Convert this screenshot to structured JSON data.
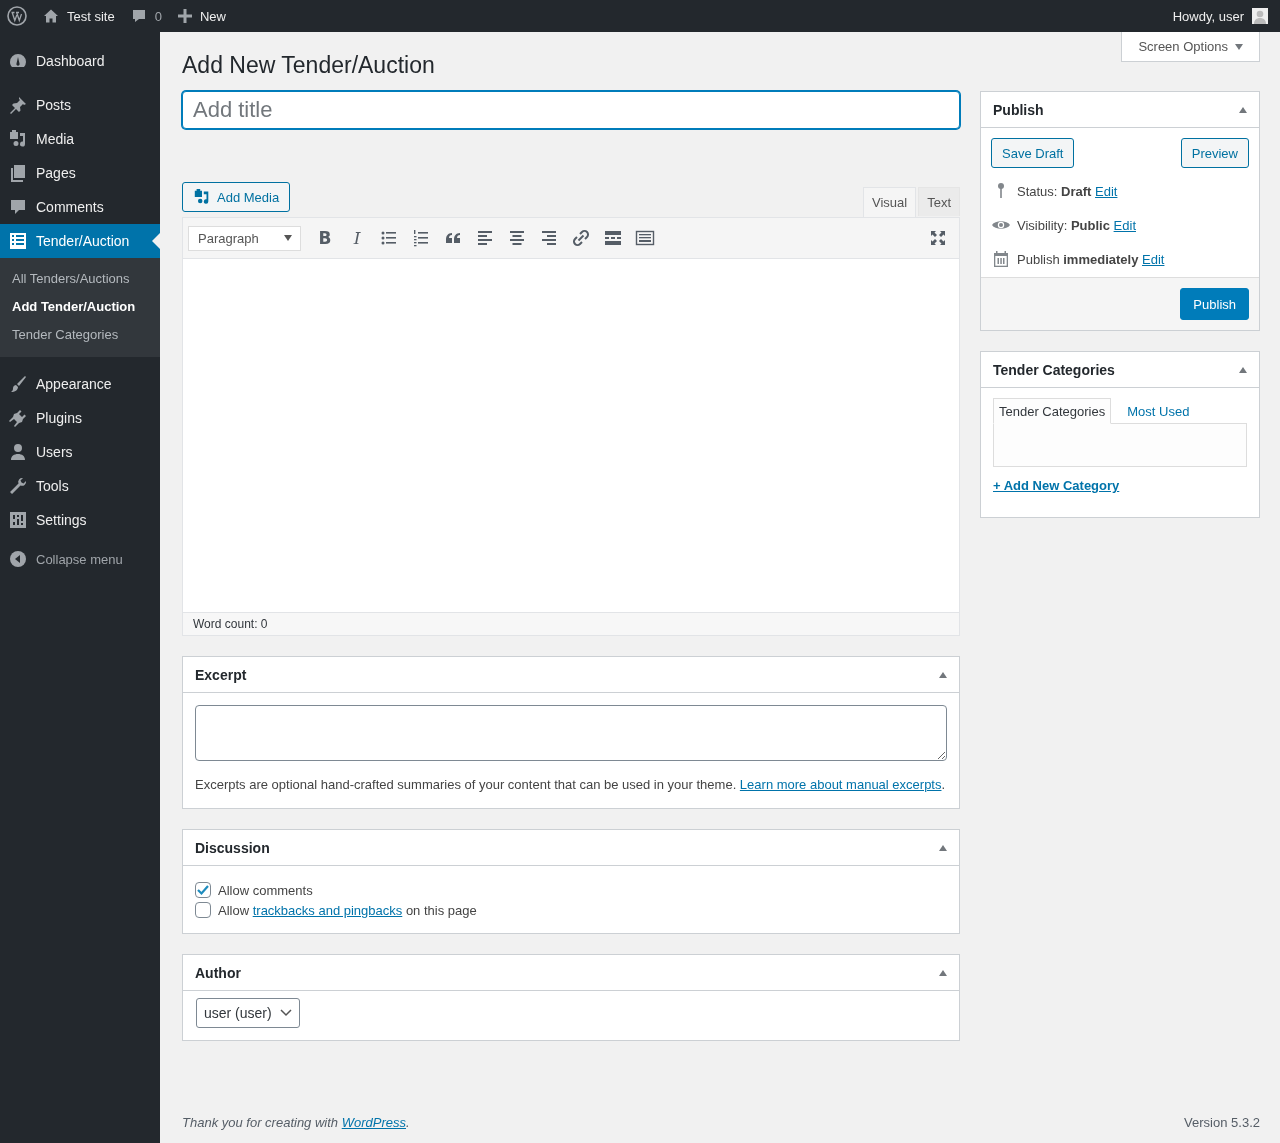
{
  "admin_bar": {
    "site": "Test site",
    "comments": "0",
    "new": "New",
    "greeting": "Howdy, user"
  },
  "menu": [
    {
      "items": [
        {
          "label": "Dashboard",
          "selected": false
        }
      ]
    },
    {
      "items": [
        {
          "label": "Posts",
          "selected": false
        },
        {
          "label": "Media",
          "selected": false
        },
        {
          "label": "Pages",
          "selected": false
        },
        {
          "label": "Comments",
          "selected": false
        },
        {
          "label": "Tender/Auction",
          "selected": true,
          "submenu": [
            {
              "label": "All Tenders/Auctions",
              "selected": false
            },
            {
              "label": "Add Tender/Auction",
              "selected": true
            },
            {
              "label": "Tender Categories",
              "selected": false
            }
          ]
        }
      ]
    },
    {
      "items": [
        {
          "label": "Appearance",
          "selected": false
        },
        {
          "label": "Plugins",
          "selected": false
        },
        {
          "label": "Users",
          "selected": false
        },
        {
          "label": "Tools",
          "selected": false
        },
        {
          "label": "Settings",
          "selected": false
        }
      ]
    }
  ],
  "collapse": "Collapse menu",
  "screen_options": "Screen Options",
  "page_title": "Add New Tender/Auction",
  "title_field": {
    "placeholder": "Add title"
  },
  "editor": {
    "add_media": "Add Media",
    "tabs": [
      {
        "label": "Visual",
        "selected": true
      },
      {
        "label": "Text",
        "selected": false
      }
    ],
    "format": "Paragraph",
    "glyphs": [
      "B",
      "I"
    ],
    "word_count": "Word count: 0"
  },
  "excerpt": {
    "title": "Excerpt",
    "note": "Excerpts are optional hand-crafted summaries of your content that can be used in your theme. ",
    "link": "Learn more about manual excerpts",
    "after": "."
  },
  "discussion": {
    "title": "Discussion",
    "options": [
      {
        "before": "Allow comments",
        "checked": true
      },
      {
        "before": "Allow ",
        "link": "trackbacks and pingbacks",
        "after": " on this page",
        "checked": false
      }
    ]
  },
  "author": {
    "title": "Author",
    "value": "user (user)"
  },
  "publish": {
    "title": "Publish",
    "save_draft": "Save Draft",
    "preview": "Preview",
    "rows": [
      {
        "text": "Status: **Draft**",
        "edit": "Edit"
      },
      {
        "text": "Visibility: **Public**",
        "edit": "Edit"
      },
      {
        "text": "Publish **immediately**",
        "edit": "Edit"
      }
    ],
    "button": "Publish"
  },
  "categories": {
    "title": "Tender Categories",
    "tabs": [
      {
        "label": "Tender Categories",
        "selected": true
      },
      {
        "label": "Most Used",
        "selected": false
      }
    ],
    "add_link": "+ Add New Category"
  },
  "footer": {
    "thanks": "Thank you for creating with ",
    "link": "WordPress",
    "after": ".",
    "version": "Version 5.3.2"
  }
}
